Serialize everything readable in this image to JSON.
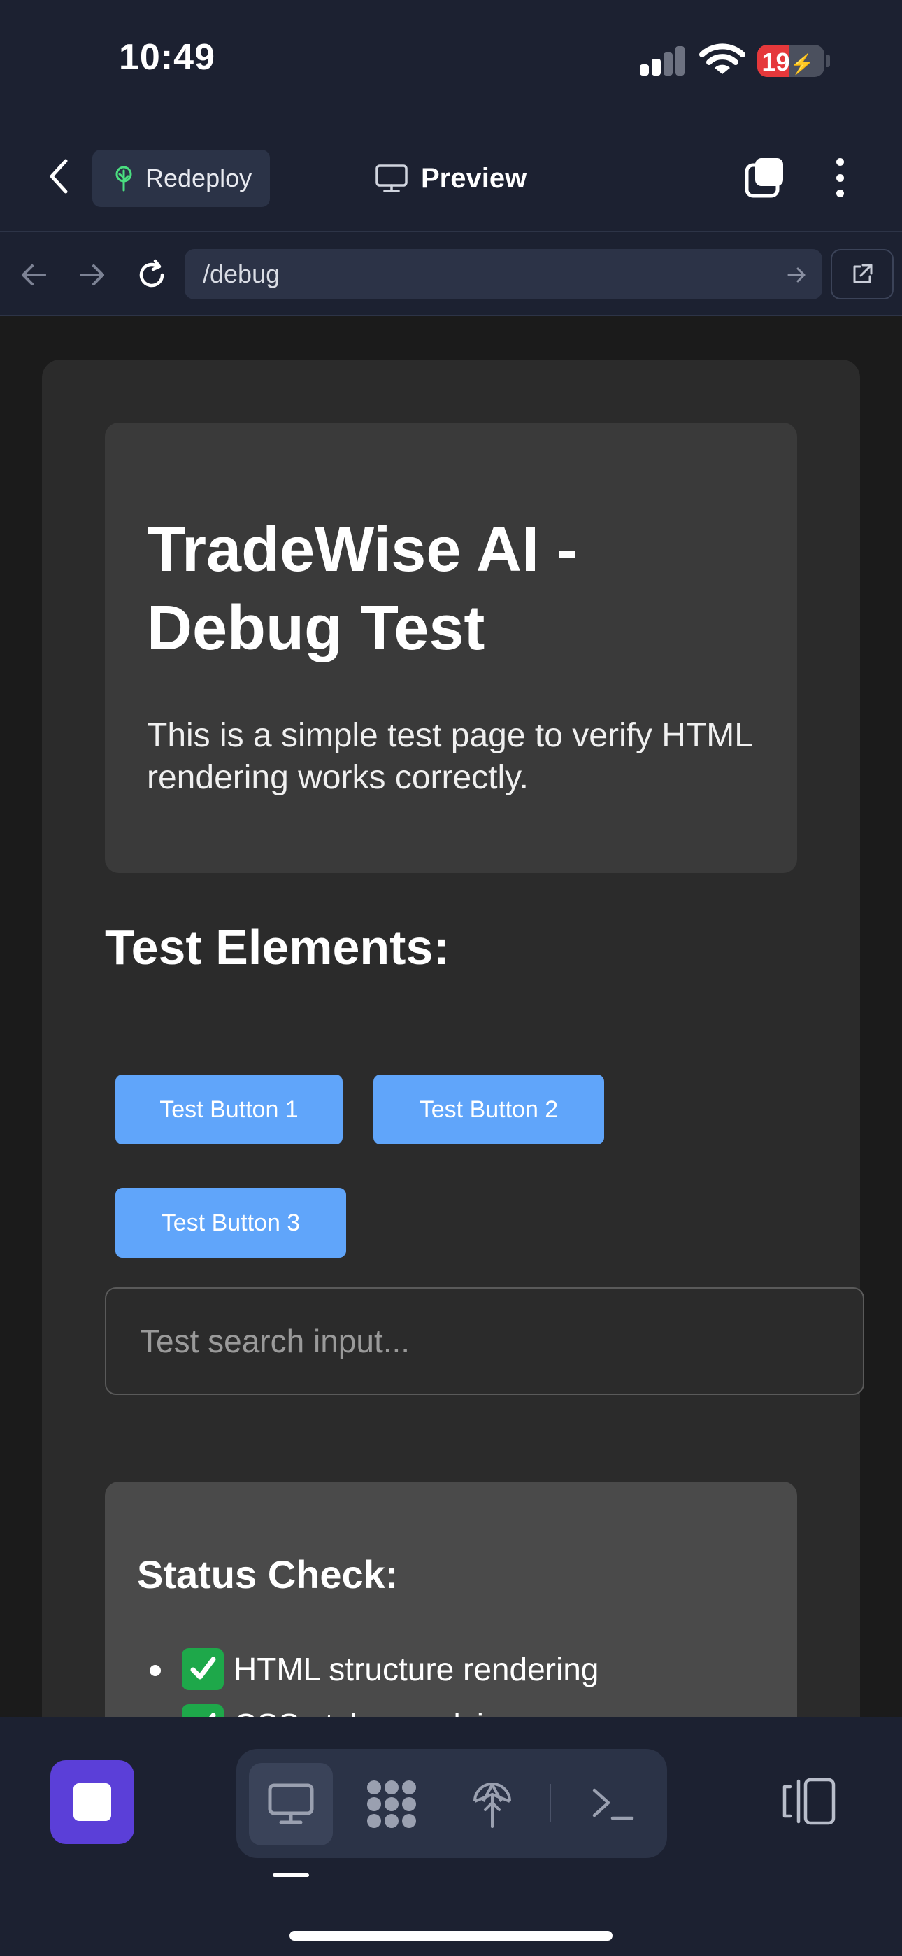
{
  "status_bar": {
    "time": "10:49",
    "battery": "19"
  },
  "header": {
    "redeploy_label": "Redeploy",
    "title": "Preview"
  },
  "browser": {
    "url": "/debug"
  },
  "page": {
    "hero_title": "TradeWise AI - Debug Test",
    "hero_description": "This is a simple test page to verify HTML rendering works correctly.",
    "section_title": "Test Elements:",
    "buttons": [
      "Test Button 1",
      "Test Button 2",
      "Test Button 3"
    ],
    "search_placeholder": "Test search input...",
    "status_title": "Status Check:",
    "status_items": [
      "HTML structure rendering",
      "CSS styles applying"
    ]
  },
  "colors": {
    "accent_button": "#60a5fa",
    "stop_button": "#5b3fd8",
    "check_green": "#1ea84a",
    "battery_low": "#e5383b"
  },
  "icons": [
    "back-icon",
    "tree-icon",
    "monitor-icon",
    "tabs-icon",
    "more-icon",
    "arrow-left-icon",
    "arrow-right-icon",
    "reload-icon",
    "go-arrow-icon",
    "external-link-icon",
    "stop-icon",
    "grid-icon",
    "deploy-icon",
    "terminal-icon",
    "layout-toggle-icon"
  ]
}
